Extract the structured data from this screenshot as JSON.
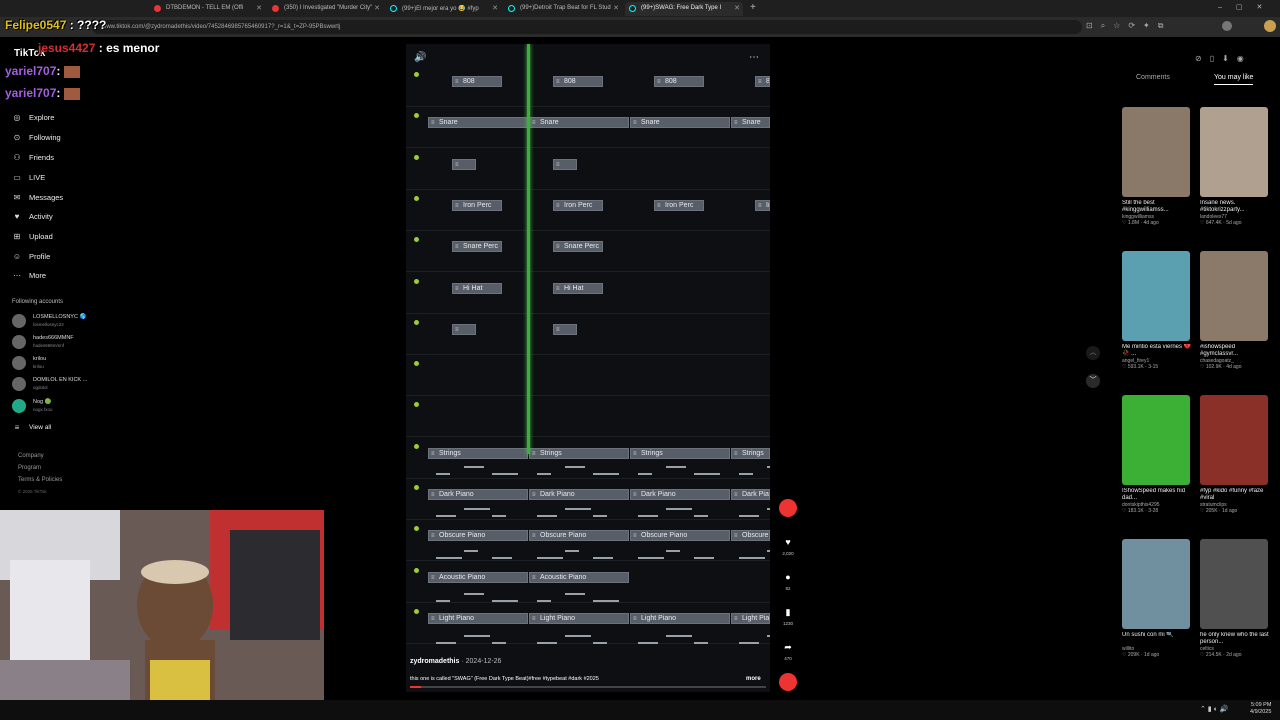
{
  "browser": {
    "tabs": [
      {
        "label": "DTBDEMON - TELL EM (Offi",
        "active": false
      },
      {
        "label": "(350) I Investigated \"Murder City\"",
        "active": false
      },
      {
        "label": "(99+)El mejor era yo 😂 #fyp",
        "active": false
      },
      {
        "label": "(99+)Detroit Trap Beat for FL Stud",
        "active": false
      },
      {
        "label": "(99+)SWAG: Free Dark Type I",
        "active": true
      }
    ],
    "url": "www.tiktok.com/@zydromadethis/video/7452846985765460917?_r=1&_t=ZP-95PBswwrtj"
  },
  "chat_overlay": [
    {
      "user": "Felipe0547",
      "text": ": ????",
      "color": "#e0c020"
    },
    {
      "user": "jesus4427",
      "text": ": es menor",
      "color": "#d23030"
    },
    {
      "user": "yariel707",
      "text": ":",
      "color": "#a060e0"
    },
    {
      "user": "yariel707",
      "text": ":",
      "color": "#a060e0"
    }
  ],
  "sidebar": {
    "logo": "TikTok",
    "items": [
      {
        "label": "Explore",
        "icon": "compass-icon",
        "glyph": "◎"
      },
      {
        "label": "Following",
        "icon": "following-icon",
        "glyph": "⊙"
      },
      {
        "label": "Friends",
        "icon": "friends-icon",
        "glyph": "⚇"
      },
      {
        "label": "LIVE",
        "icon": "live-icon",
        "glyph": "▭"
      },
      {
        "label": "Messages",
        "icon": "messages-icon",
        "glyph": "✉"
      },
      {
        "label": "Activity",
        "icon": "activity-icon",
        "glyph": "♥"
      },
      {
        "label": "Upload",
        "icon": "upload-icon",
        "glyph": "⊞"
      },
      {
        "label": "Profile",
        "icon": "profile-icon",
        "glyph": "☺"
      },
      {
        "label": "More",
        "icon": "more-icon",
        "glyph": "⋯"
      }
    ],
    "following_header": "Following accounts",
    "accounts": [
      {
        "name": "LOSMELLOSNYC 🌎",
        "handle": "losmellosnyc22"
      },
      {
        "name": "hades666MMNF",
        "handle": "hades666mmnf"
      },
      {
        "name": "krilou",
        "handle": "krilou"
      },
      {
        "name": "DOMILOL EN KICK ...",
        "handle": "ogdolol"
      },
      {
        "name": "Nog 🟢",
        "handle": "nogx.fxoo"
      }
    ],
    "view_all": "View all",
    "footer": [
      "Company",
      "Program",
      "Terms & Policies",
      "© 2025 TikTok"
    ]
  },
  "video": {
    "tracks": [
      {
        "name": "808"
      },
      {
        "name": "Snare"
      },
      {
        "name": ""
      },
      {
        "name": "Iron Perc"
      },
      {
        "name": "Snare Perc"
      },
      {
        "name": "Hi Hat"
      },
      {
        "name": ""
      },
      {
        "name": ""
      },
      {
        "name": ""
      },
      {
        "name": "Strings"
      },
      {
        "name": "Dark Piano"
      },
      {
        "name": "Obscure Piano"
      },
      {
        "name": "Acoustic Piano"
      },
      {
        "name": "Light Piano"
      }
    ],
    "author": "zydromadethis",
    "date": "2024-12-26",
    "caption": "this one is called \"SWAG\" (Free Dark Type Beat)#free #typebeat #dark #2025",
    "more_label": "more",
    "likes": "2,020",
    "comments": "82",
    "saves": "1230",
    "shares": "470"
  },
  "right_panel": {
    "tabs": [
      "Comments",
      "You may like"
    ],
    "cards": [
      {
        "caption": "Still the best #kinggwilliamss...",
        "user": "kinggwilliamss",
        "views": "1.8M",
        "age": "4d ago",
        "color": "#8a7868"
      },
      {
        "caption": "Insane news. #tiktokrizzparty...",
        "user": "landolees77",
        "views": "647.4K",
        "age": "5d ago",
        "color": "#b0a090"
      },
      {
        "caption": "Me mintió esta viernes 💔 🥀 ...",
        "user": "angel_firey1",
        "views": "593.1K",
        "age": "3-15",
        "color": "#5aa0b0"
      },
      {
        "caption": "#ishowspeed #gymclassvr...",
        "user": "chasedagoatz_",
        "views": "102.9K",
        "age": "4d ago",
        "color": "#8b7a6a"
      },
      {
        "caption": "IShowSpeed makes hid dad...",
        "user": "dontskipthis4295",
        "views": "183.1K",
        "age": "3-28",
        "color": "#3cb034"
      },
      {
        "caption": "#fyp #kido #funny #faze #viral",
        "user": "stratumclips",
        "views": "205K",
        "age": "1d ago",
        "color": "#8a3028"
      },
      {
        "caption": "Un sushi con mi 🔍",
        "user": "willito",
        "views": "209K",
        "age": "1d ago",
        "color": "#7090a0"
      },
      {
        "caption": "he only knew who the last person...",
        "user": "celtics",
        "views": "214.5K",
        "age": "2d ago",
        "color": "#505050"
      }
    ]
  },
  "taskbar": {
    "time": "5:09 PM",
    "date": "4/9/2025"
  }
}
